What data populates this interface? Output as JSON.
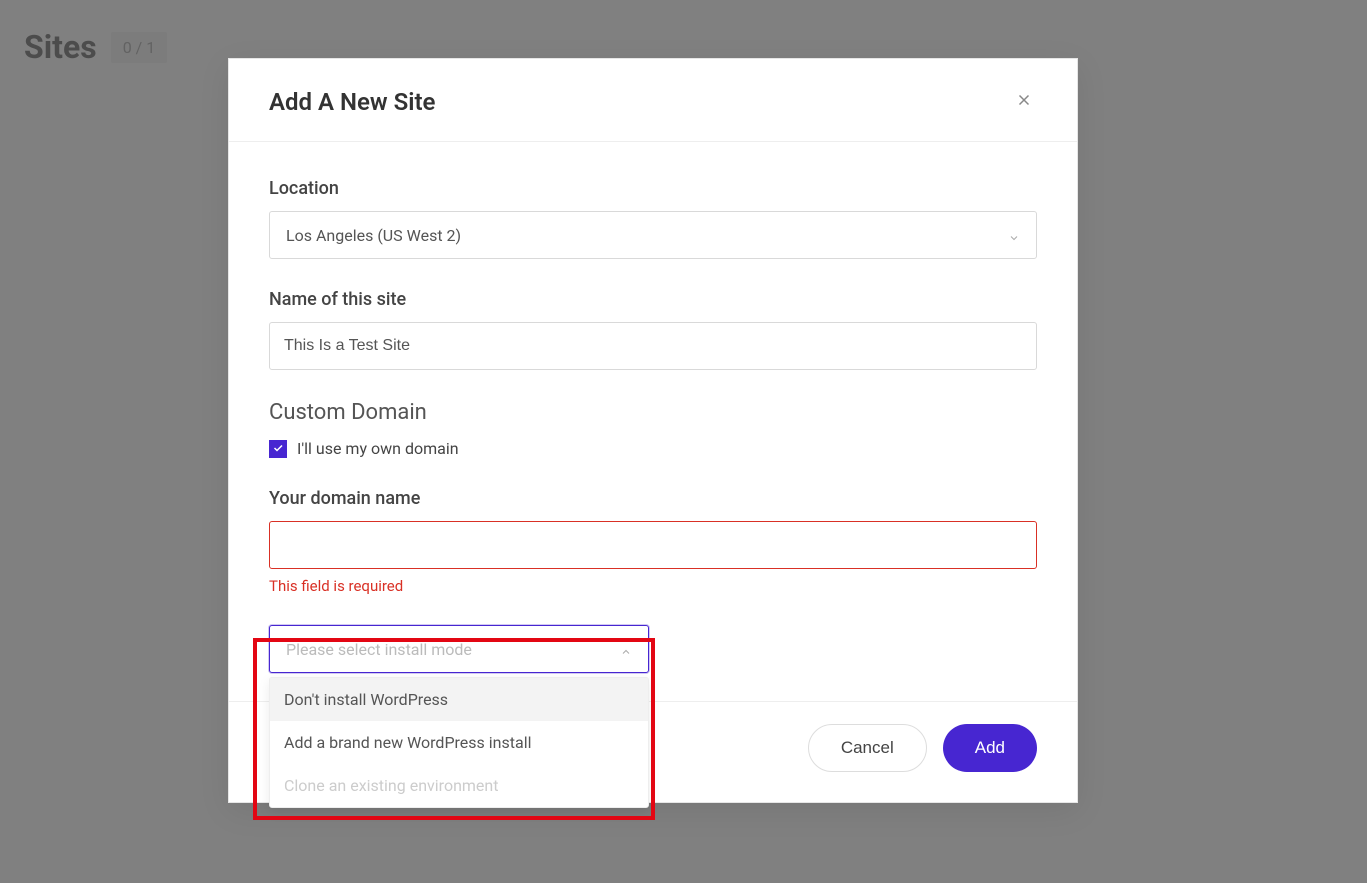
{
  "page": {
    "title": "Sites",
    "count_badge": "0 / 1"
  },
  "modal": {
    "title": "Add A New Site",
    "location": {
      "label": "Location",
      "value": "Los Angeles (US West 2)"
    },
    "site_name": {
      "label": "Name of this site",
      "value": "This Is a Test Site"
    },
    "custom_domain": {
      "section_label": "Custom Domain",
      "checkbox_label": "I'll use my own domain",
      "checked": true
    },
    "domain_name": {
      "label": "Your domain name",
      "value": "",
      "error": "This field is required"
    },
    "install_mode": {
      "placeholder": "Please select install mode",
      "options": [
        {
          "label": "Don't install WordPress",
          "highlighted": true,
          "disabled": false
        },
        {
          "label": "Add a brand new WordPress install",
          "highlighted": false,
          "disabled": false
        },
        {
          "label": "Clone an existing environment",
          "highlighted": false,
          "disabled": true
        }
      ]
    },
    "footer": {
      "cancel": "Cancel",
      "add": "Add"
    }
  }
}
